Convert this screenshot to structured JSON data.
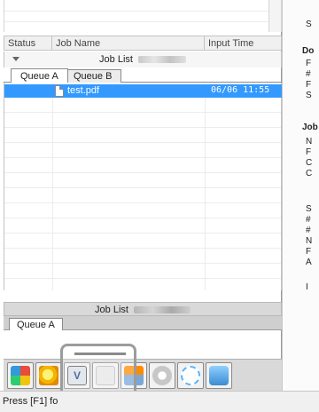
{
  "header": {
    "columns": [
      "Status",
      "Job Name",
      "Input Time"
    ]
  },
  "job_list": {
    "title": "Job List",
    "tabs": [
      "Queue A",
      "Queue B"
    ],
    "jobs": [
      {
        "name": "test.pdf",
        "time": "06/06 11:55"
      }
    ]
  },
  "job_list_2": {
    "title": "Job List",
    "tab": "Queue A"
  },
  "toolbar": {
    "icons": [
      "color-grid-icon",
      "sun-icon",
      "preview-icon",
      "blank-icon",
      "import-icon",
      "disc-icon",
      "spinner-icon",
      "trash-icon"
    ]
  },
  "status": {
    "text": "Press [F1] fo"
  },
  "right_panel": {
    "lines": [
      "S",
      "Do",
      "F",
      "#",
      "F",
      "S",
      "Job",
      "N",
      "F",
      "C",
      "C",
      "S",
      "#",
      "#",
      "N",
      "F",
      "A",
      "I"
    ]
  }
}
